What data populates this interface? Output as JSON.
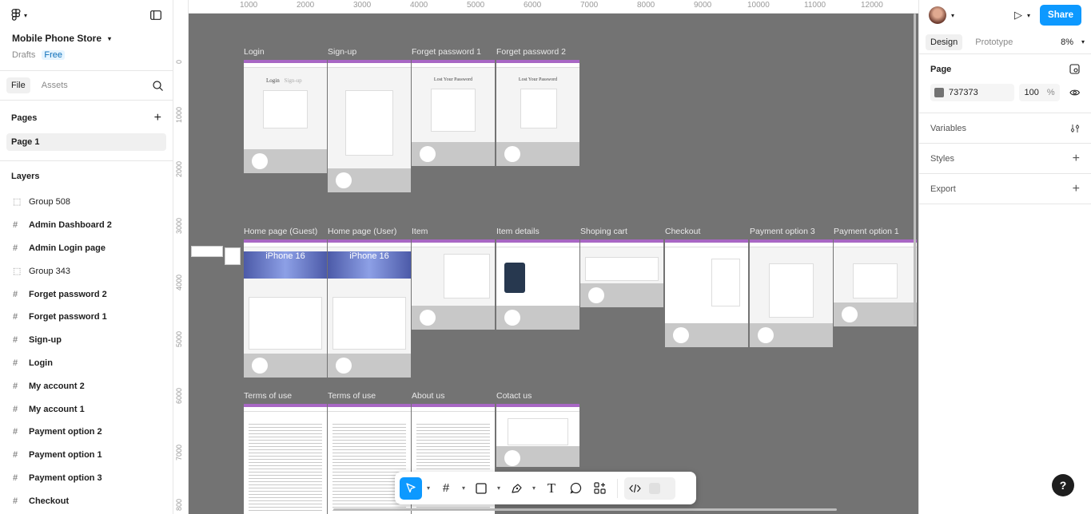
{
  "app": {
    "project_name": "Mobile Phone Store",
    "location": "Drafts",
    "plan_badge": "Free"
  },
  "left_panel": {
    "tabs": [
      "File",
      "Assets"
    ],
    "pages_heading": "Pages",
    "pages": [
      "Page 1"
    ],
    "layers_heading": "Layers",
    "layers": [
      {
        "label": "Group 508",
        "kind": "group"
      },
      {
        "label": "Admin Dashboard 2",
        "kind": "frame"
      },
      {
        "label": "Admin Login page",
        "kind": "frame"
      },
      {
        "label": "Group 343",
        "kind": "group"
      },
      {
        "label": "Forget password 2",
        "kind": "frame"
      },
      {
        "label": "Forget password 1",
        "kind": "frame"
      },
      {
        "label": "Sign-up",
        "kind": "frame"
      },
      {
        "label": "Login",
        "kind": "frame"
      },
      {
        "label": "My account 2",
        "kind": "frame"
      },
      {
        "label": "My account 1",
        "kind": "frame"
      },
      {
        "label": "Payment option 2",
        "kind": "frame"
      },
      {
        "label": "Payment option 1",
        "kind": "frame"
      },
      {
        "label": "Payment option 3",
        "kind": "frame"
      },
      {
        "label": "Checkout",
        "kind": "frame"
      }
    ]
  },
  "canvas": {
    "ruler_top": [
      "1000",
      "2000",
      "3000",
      "4000",
      "5000",
      "6000",
      "7000",
      "8000",
      "9000",
      "10000",
      "11000",
      "12000"
    ],
    "ruler_left": [
      "0",
      "1000",
      "2000",
      "3000",
      "4000",
      "5000",
      "6000",
      "7000",
      "800"
    ],
    "frames": {
      "login": "Login",
      "signup": "Sign-up",
      "forget1": "Forget password 1",
      "forget2": "Forget password 2",
      "home_guest": "Home page (Guest)",
      "home_user": "Home page (User)",
      "item": "Item",
      "item_details": "Item details",
      "cart": "Shoping cart",
      "checkout": "Checkout",
      "pay3": "Payment option 3",
      "pay1": "Payment option 1",
      "terms1": "Terms of use",
      "terms2": "Terms of use",
      "about": "About us",
      "contact": "Cotact us"
    },
    "frame_text": {
      "login_title": "Login",
      "login_tab2": "Sign-up",
      "lost_password_title": "Lost Your Password",
      "hero_text": "iPhone 16"
    }
  },
  "right_panel": {
    "share_label": "Share",
    "tabs": [
      "Design",
      "Prototype"
    ],
    "zoom": "8%",
    "page_section": {
      "title": "Page",
      "color_hex": "737373",
      "color": "#737373",
      "opacity": "100",
      "opacity_unit": "%"
    },
    "sections": [
      "Variables",
      "Styles",
      "Export"
    ]
  },
  "help_label": "?"
}
